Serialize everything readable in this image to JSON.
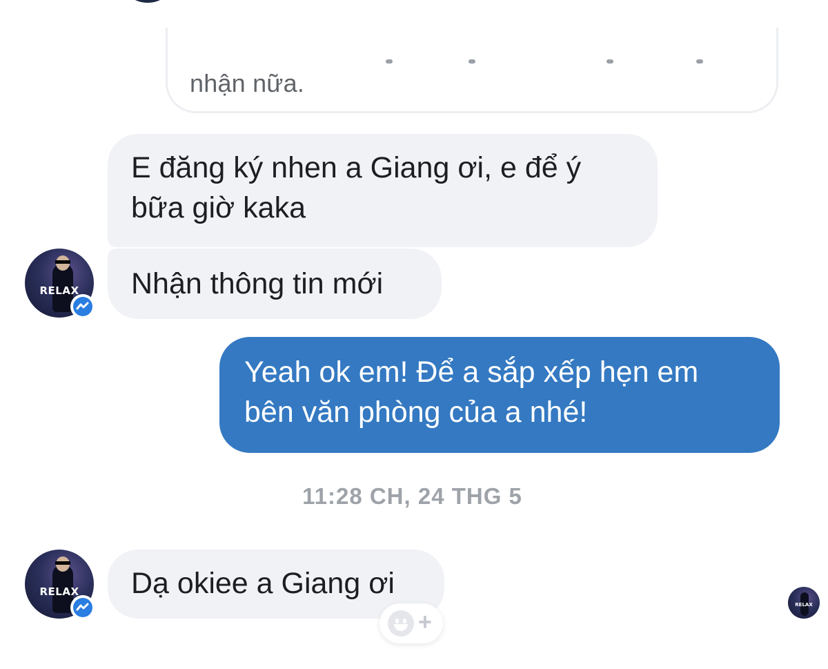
{
  "conversation": {
    "quoted_message_tail": "nhận nữa.",
    "messages": [
      {
        "sender": "contact",
        "text_line1": "E đăng ký nhen a Giang ơi, e để ý",
        "text_line2": "bữa giờ kaka"
      },
      {
        "sender": "contact",
        "text": "Nhận thông tin mới"
      },
      {
        "sender": "me",
        "text_line1": "Yeah ok em! Để a sắp xếp hẹn em",
        "text_line2": "bên văn phòng của a nhé!"
      },
      {
        "sender": "contact",
        "text": "Dạ okiee a Giang ơi"
      }
    ],
    "timestamp": "11:28 CH, 24 THG 5"
  },
  "avatar": {
    "label": "RELAX",
    "badge_icon": "messenger-icon"
  },
  "reaction": {
    "icon": "smiley-add-reaction-icon",
    "plus": "+"
  },
  "colors": {
    "outgoing_bubble": "#3479c2",
    "incoming_bubble": "#f1f2f6",
    "timestamp": "#9ea3a9",
    "messenger_badge": "#2a7de1"
  }
}
